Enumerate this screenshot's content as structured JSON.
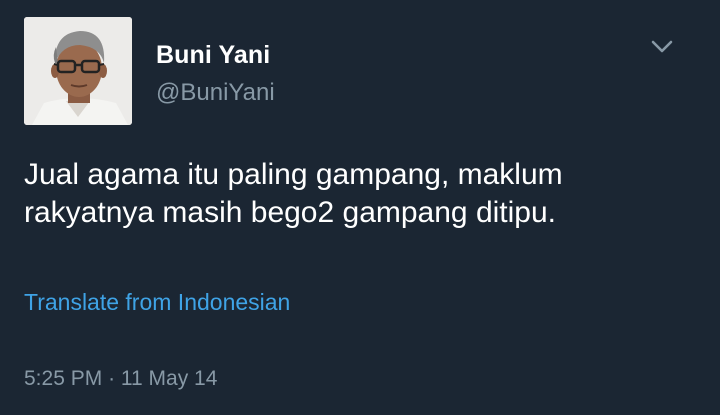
{
  "tweet": {
    "author": {
      "name": "Buni Yani",
      "handle": "@BuniYani"
    },
    "text_lines": [
      "Jual agama itu paling gampang, maklum",
      "rakyatnya masih bego2 gampang ditipu."
    ],
    "translate_label": "Translate from Indonesian",
    "time": "5:25 PM",
    "separator": "·",
    "date": "11 May 14"
  },
  "icons": {
    "menu": "chevron-down-icon",
    "avatar": "profile-photo"
  },
  "colors": {
    "background": "#1b2633",
    "text": "#ffffff",
    "secondary_text": "#8899a6",
    "link": "#3fa3e6"
  }
}
